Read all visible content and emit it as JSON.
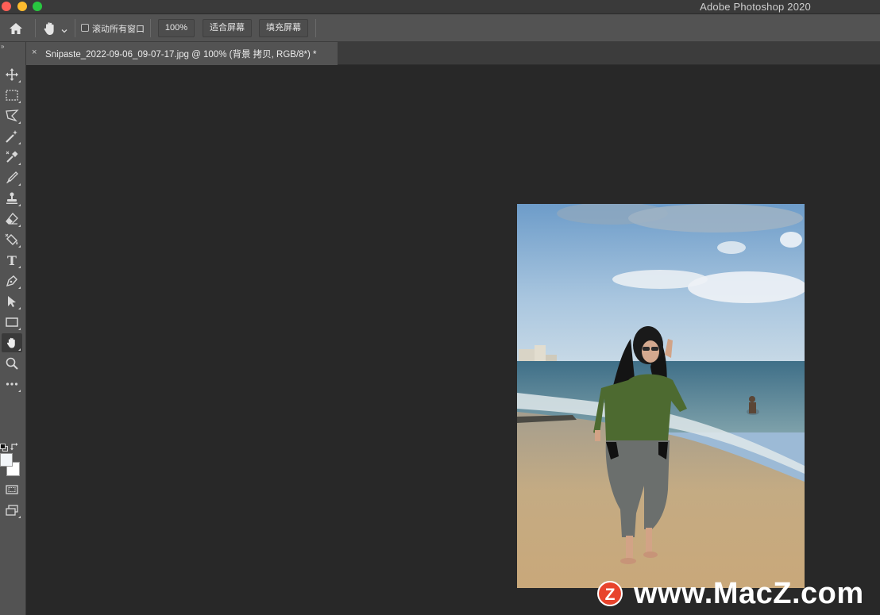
{
  "window": {
    "app_title": "Adobe Photoshop 2020"
  },
  "options_bar": {
    "scroll_all_windows_label": "滚动所有窗口",
    "scroll_all_windows_checked": false,
    "zoom_button": "100%",
    "fit_screen_button": "适合屏幕",
    "fill_screen_button": "填充屏幕"
  },
  "document_tab": {
    "close_glyph": "×",
    "title": "Snipaste_2022-09-06_09-07-17.jpg @ 100% (背景 拷贝, RGB/8*) *"
  },
  "toolbar": {
    "collapse_glyph": "»",
    "tools": [
      {
        "name": "move-tool",
        "icon": "move-icon"
      },
      {
        "name": "marquee-tool",
        "icon": "rect-marquee-icon"
      },
      {
        "name": "lasso-tool",
        "icon": "polygon-lasso-icon"
      },
      {
        "name": "magic-wand-tool",
        "icon": "magic-wand-icon"
      },
      {
        "name": "eyedropper-tool",
        "icon": "eyedropper-icon"
      },
      {
        "name": "brush-tool",
        "icon": "brush-icon"
      },
      {
        "name": "stamp-tool",
        "icon": "stamp-icon"
      },
      {
        "name": "eraser-tool",
        "icon": "eraser-icon"
      },
      {
        "name": "paint-bucket-tool",
        "icon": "paint-bucket-icon"
      },
      {
        "name": "type-tool",
        "icon": "type-icon",
        "glyph": "T"
      },
      {
        "name": "pen-tool",
        "icon": "pen-icon"
      },
      {
        "name": "path-select-tool",
        "icon": "arrow-icon"
      },
      {
        "name": "rectangle-tool",
        "icon": "rectangle-icon"
      },
      {
        "name": "hand-tool",
        "icon": "hand-icon",
        "active": true
      },
      {
        "name": "zoom-tool",
        "icon": "magnifier-icon"
      },
      {
        "name": "more-tools",
        "icon": "ellipsis-icon"
      }
    ],
    "foreground_color": "#f3f6f9",
    "background_color": "#ffffff"
  },
  "watermark": {
    "logo_letter": "Z",
    "text": "www.MacZ.com"
  },
  "colors": {
    "ui_panel": "#535353",
    "canvas_bg": "#282828",
    "watermark_logo": "#e8442d"
  }
}
